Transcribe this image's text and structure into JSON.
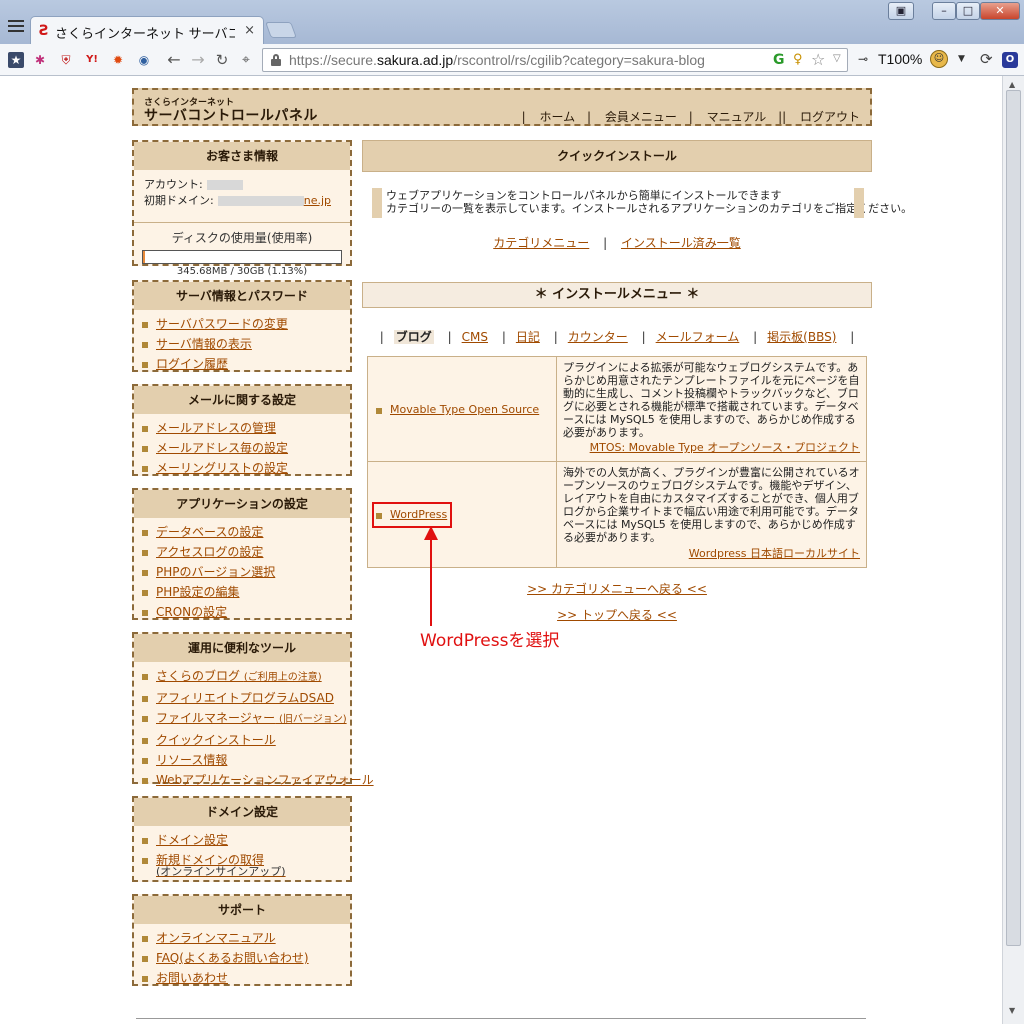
{
  "browser": {
    "tab_title": "さくらインターネット サーバコン…",
    "tab_close": "×",
    "url_prefix": "https://secure.",
    "url_domain": "sakura.ad.jp",
    "url_path": "/rscontrol/rs/cgilib?category=sakura-blog",
    "zoom": "T100%",
    "extensions": [
      "star-icon",
      "dots-icon",
      "shield-icon",
      "yahoo-icon",
      "gear-red-icon",
      "eye-icon",
      "back-icon",
      "forward-icon",
      "reload-icon",
      "target-icon"
    ]
  },
  "header": {
    "logo_small": "さくらインターネット",
    "logo_main": "サーバコントロールパネル",
    "nav": [
      "ホーム",
      "会員メニュー",
      "マニュアル",
      "ログアウト"
    ]
  },
  "account": {
    "title": "お客さま情報",
    "account_label": "アカウント:",
    "domain_label": "初期ドメイン:",
    "domain_tail": "ne.jp",
    "disk_label": "ディスクの使用量(使用率)",
    "disk_usage": "345.68MB / 30GB (1.13%)",
    "disk_ratio": 0.0113
  },
  "sidebar": [
    {
      "title": "サーバ情報とパスワード",
      "items": [
        "サーバパスワードの変更",
        "サーバ情報の表示",
        "ログイン履歴"
      ]
    },
    {
      "title": "メールに関する設定",
      "items": [
        "メールアドレスの管理",
        "メールアドレス毎の設定",
        "メーリングリストの設定"
      ]
    },
    {
      "title": "アプリケーションの設定",
      "items": [
        "データベースの設定",
        "アクセスログの設定",
        "PHPのバージョン選択",
        "PHP設定の編集",
        "CRONの設定"
      ]
    },
    {
      "title": "運用に便利なツール",
      "items": [
        "さくらのブログ",
        "アフィリエイトプログラムDSAD",
        "ファイルマネージャー",
        "クイックインストール",
        "リソース情報",
        "Webアプリケーションファイアウォール"
      ]
    },
    {
      "title": "ドメイン設定",
      "items": [
        "ドメイン設定",
        "新規ドメインの取得"
      ]
    },
    {
      "title": "サポート",
      "items": [
        "オンラインマニュアル",
        "FAQ(よくあるお問い合わせ)",
        "お問いあわせ"
      ]
    }
  ],
  "sidebar_notes": {
    "blog_note": "(ご利用上の注意)",
    "filemgr_note": "(旧バージョン)",
    "newdomain_note": "(オンラインサインアップ)"
  },
  "main": {
    "title": "クイックインストール",
    "intro_line1": "ウェブアプリケーションをコントロールパネルから簡単にインストールできます",
    "intro_line2": "カテゴリーの一覧を表示しています。インストールされるアプリケーションのカテゴリをご指定ください。",
    "link_category": "カテゴリメニュー",
    "link_installed": "インストール済み一覧",
    "install_menu": "＊ インストールメニュー ＊",
    "categories": [
      "ブログ",
      "CMS",
      "日記",
      "カウンター",
      "メールフォーム",
      "掲示板(BBS)"
    ],
    "apps": [
      {
        "name": "Movable Type Open Source",
        "desc": "プラグインによる拡張が可能なウェブログシステムです。あらかじめ用意されたテンプレートファイルを元にページを自動的に生成し、コメント投稿欄やトラックバックなど、ブログに必要とされる機能が標準で搭載されています。データベースには MySQL5 を使用しますので、あらかじめ作成する必要があります。",
        "site": "MTOS: Movable Type オープンソース・プロジェクト"
      },
      {
        "name": "WordPress",
        "desc": "海外での人気が高く、プラグインが豊富に公開されているオープンソースのウェブログシステムです。機能やデザイン、レイアウトを自由にカスタマイズすることができ、個人用ブログから企業サイトまで幅広い用途で利用可能です。データベースには MySQL5 を使用しますので、あらかじめ作成する必要があります。",
        "site": "Wordpress 日本語ローカルサイト"
      }
    ],
    "back_category": ">> カテゴリメニューへ戻る <<",
    "back_top": ">> トップへ戻る <<"
  },
  "annotation": {
    "label": "WordPressを選択",
    "color": "#e01010"
  }
}
